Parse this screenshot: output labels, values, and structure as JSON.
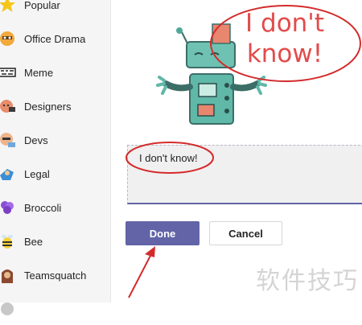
{
  "sidebar": {
    "items": [
      {
        "label": "Popular",
        "icon": "star-icon"
      },
      {
        "label": "Office Drama",
        "icon": "office-drama-icon"
      },
      {
        "label": "Meme",
        "icon": "meme-icon"
      },
      {
        "label": "Designers",
        "icon": "designers-icon"
      },
      {
        "label": "Devs",
        "icon": "devs-icon"
      },
      {
        "label": "Legal",
        "icon": "legal-icon"
      },
      {
        "label": "Broccoli",
        "icon": "broccoli-icon"
      },
      {
        "label": "Bee",
        "icon": "bee-icon"
      },
      {
        "label": "Teamsquatch",
        "icon": "teamsquatch-icon"
      }
    ]
  },
  "sticker": {
    "bubble_line1": "I don't",
    "bubble_line2": "know!"
  },
  "editor": {
    "text": "I don't know!"
  },
  "buttons": {
    "done_label": "Done",
    "cancel_label": "Cancel"
  },
  "watermark": "软件技巧",
  "colors": {
    "accent": "#6264a7",
    "annotation": "#d42b2b",
    "robot_teal": "#5fb8a8"
  }
}
